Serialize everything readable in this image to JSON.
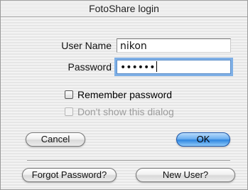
{
  "window": {
    "title": "FotoShare login"
  },
  "form": {
    "username_label": "User Name",
    "username_value": "nikon",
    "password_label": "Password",
    "password_masked": "••••••"
  },
  "options": {
    "remember_label": "Remember password",
    "dont_show_label": "Don't show this dialog"
  },
  "buttons": {
    "cancel": "Cancel",
    "ok": "OK",
    "forgot": "Forgot Password?",
    "new_user": "New User?"
  },
  "colors": {
    "focus_ring": "#7fb0e6",
    "default_button": "#2f86e0"
  }
}
